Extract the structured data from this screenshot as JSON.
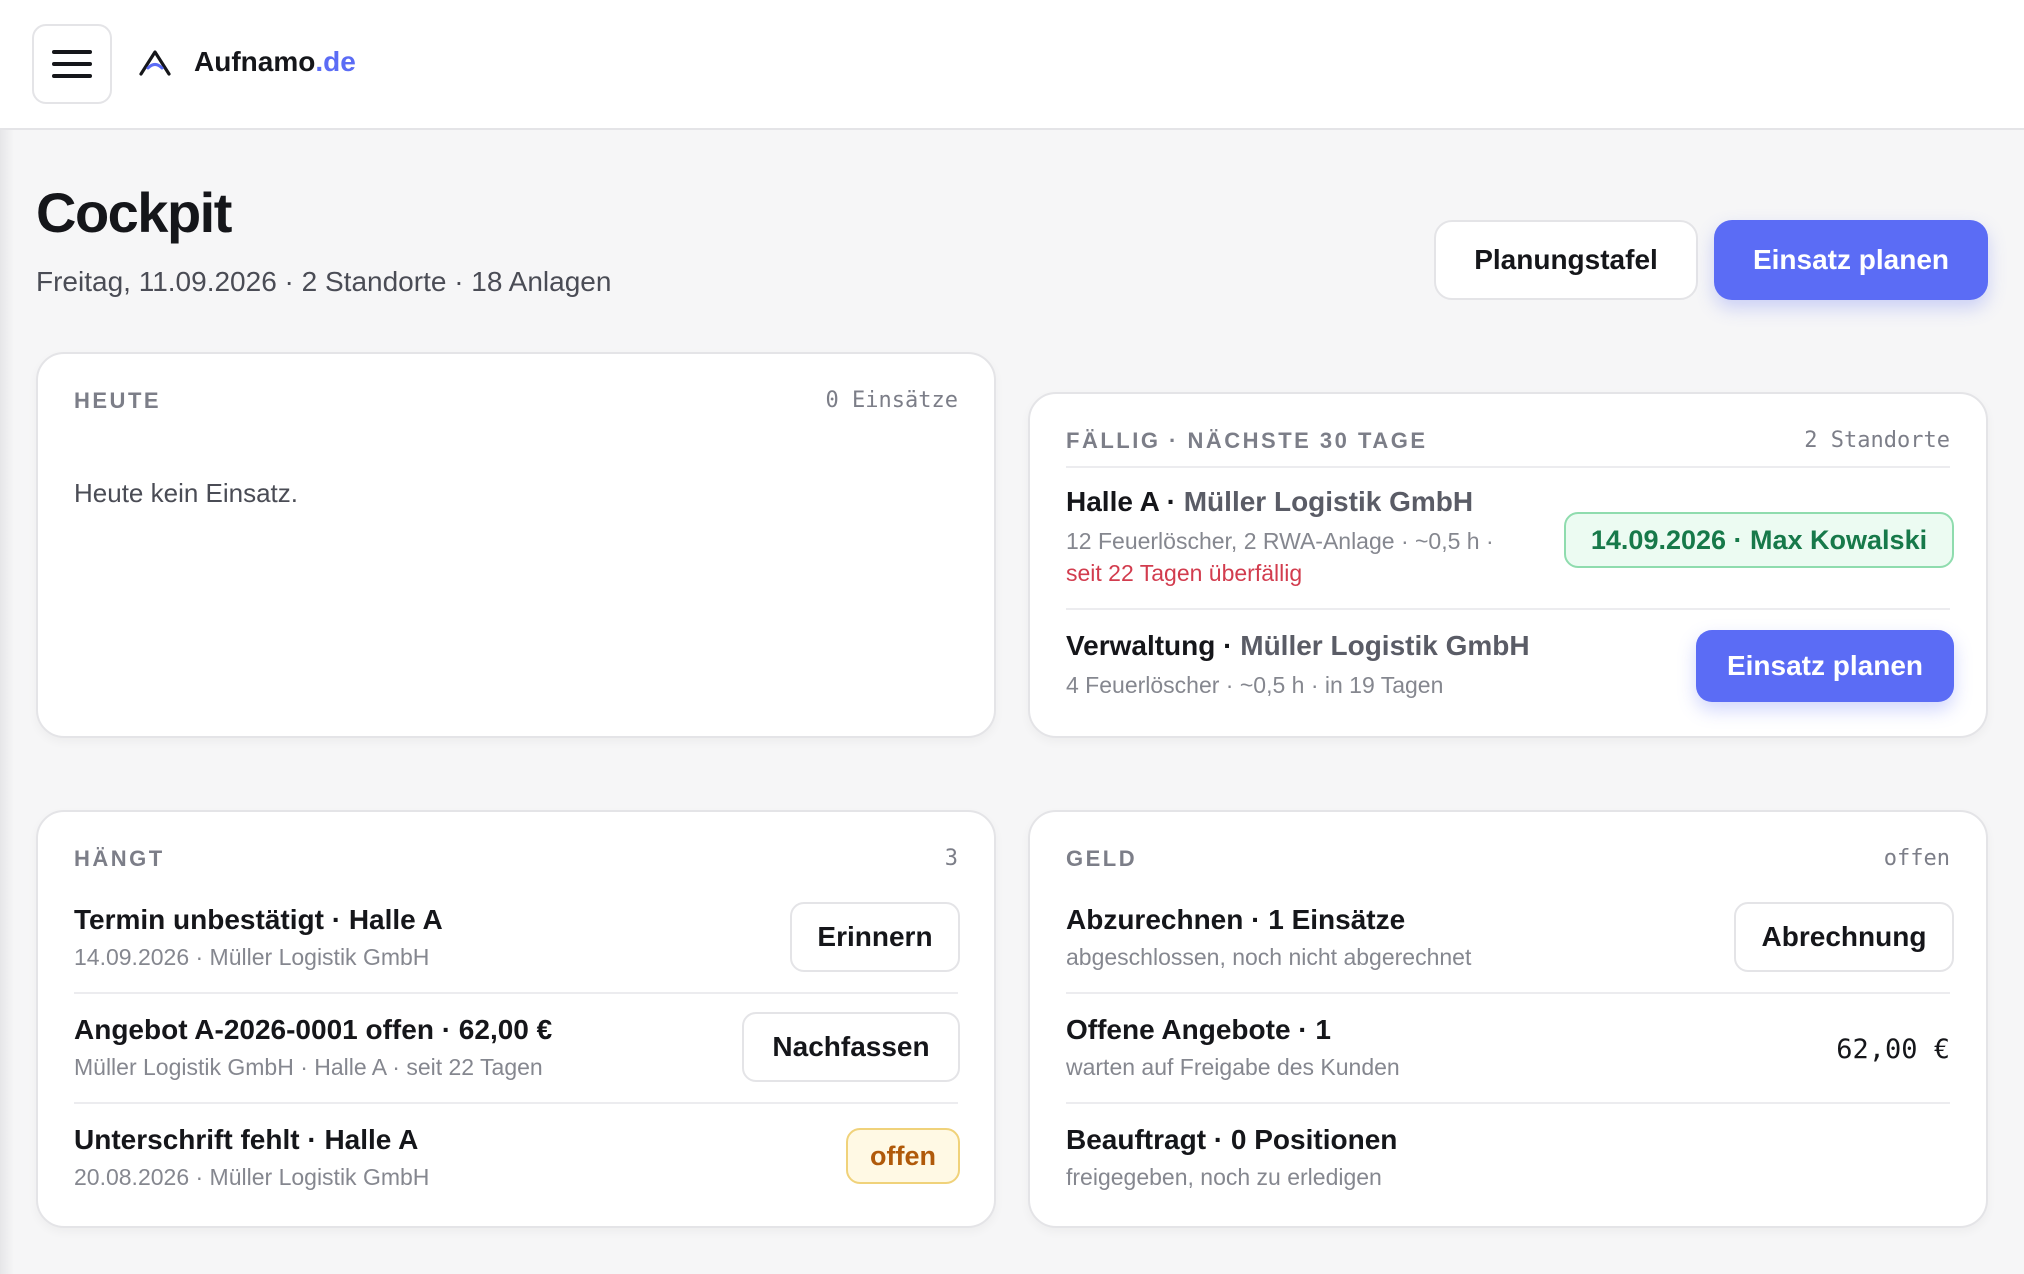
{
  "header": {
    "brand_name": "Aufnamo",
    "brand_tld": ".de"
  },
  "page": {
    "title": "Cockpit",
    "subtitle": "Freitag, 11.09.2026 · 2 Standorte · 18 Anlagen",
    "planungstafel_label": "Planungstafel",
    "einsatz_planen_label": "Einsatz planen"
  },
  "heute": {
    "label": "HEUTE",
    "meta": "0 Einsätze",
    "empty": "Heute kein Einsatz."
  },
  "faellig": {
    "label": "FÄLLIG · NÄCHSTE 30 TAGE",
    "meta": "2 Standorte",
    "items": [
      {
        "site": "Halle A ·",
        "customer": "Müller Logistik GmbH",
        "details": "12 Feuerlöscher, 2 RWA-Anlage · ~0,5 h ·",
        "overdue": "seit 22 Tagen überfällig",
        "chip": "14.09.2026 · Max Kowalski"
      },
      {
        "site": "Verwaltung ·",
        "customer": "Müller Logistik GmbH",
        "details": "4 Feuerlöscher · ~0,5 h · in 19 Tagen",
        "action": "Einsatz planen"
      }
    ]
  },
  "haengt": {
    "label": "HÄNGT",
    "meta": "3",
    "items": [
      {
        "title": "Termin unbestätigt · Halle A",
        "sub": "14.09.2026 · Müller Logistik GmbH",
        "action": "Erinnern"
      },
      {
        "title": "Angebot A-2026-0001 offen · 62,00 €",
        "sub": "Müller Logistik GmbH · Halle A · seit 22 Tagen",
        "action": "Nachfassen"
      },
      {
        "title": "Unterschrift fehlt · Halle A",
        "sub": "20.08.2026 · Müller Logistik GmbH",
        "badge": "offen"
      }
    ]
  },
  "geld": {
    "label": "GELD",
    "meta": "offen",
    "items": [
      {
        "title": "Abzurechnen · 1 Einsätze",
        "sub": "abgeschlossen, noch nicht abgerechnet",
        "action": "Abrechnung"
      },
      {
        "title": "Offene Angebote · 1",
        "sub": "warten auf Freigabe des Kunden",
        "amount": "62,00 €"
      },
      {
        "title": "Beauftragt · 0 Positionen",
        "sub": "freigegeben, noch zu erledigen"
      }
    ]
  },
  "colors": {
    "accent": "#5b6cf5",
    "success": "#17794a",
    "danger": "#d23c4e",
    "warning": "#b05a0a"
  },
  "icons": {
    "menu": "hamburger-menu-icon",
    "logo": "aufnamo-logo-icon"
  }
}
